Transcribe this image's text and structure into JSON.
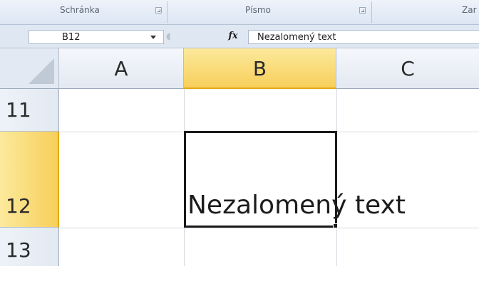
{
  "ribbon": {
    "groups": [
      {
        "label": "Schránka"
      },
      {
        "label": "Písmo"
      },
      {
        "label": "Zar"
      }
    ]
  },
  "formula_bar": {
    "name_box_value": "B12",
    "fx_label": "fx",
    "formula_value": "Nezalomený text"
  },
  "grid": {
    "columns": [
      "A",
      "B",
      "C"
    ],
    "rows": [
      "11",
      "12",
      "13"
    ],
    "selected_cell": "B12",
    "cell_b12_text": "Nezalomený text"
  },
  "colors": {
    "selection_header": "#f7cf5b",
    "header_bg": "#e3e9f2",
    "gridline": "#d4d9e0"
  }
}
